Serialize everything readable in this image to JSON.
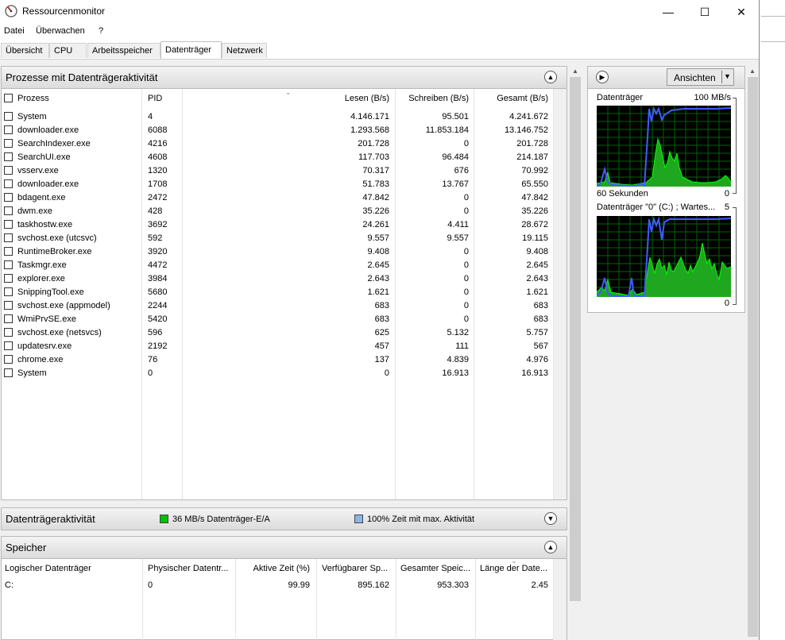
{
  "window": {
    "title": "Ressourcenmonitor",
    "minimize": "—",
    "maximize": "☐",
    "close": "✕"
  },
  "menu": [
    "Datei",
    "Überwachen",
    "?"
  ],
  "tabs": [
    "Übersicht",
    "CPU",
    "Arbeitsspeicher",
    "Datenträger",
    "Netzwerk"
  ],
  "active_tab": "Datenträger",
  "processes": {
    "title": "Prozesse mit Datenträgeraktivität",
    "columns": [
      "Prozess",
      "PID",
      "Lesen (B/s)",
      "Schreiben (B/s)",
      "Gesamt (B/s)"
    ],
    "rows": [
      [
        "System",
        "4",
        "4.146.171",
        "95.501",
        "4.241.672"
      ],
      [
        "downloader.exe",
        "6088",
        "1.293.568",
        "11.853.184",
        "13.146.752"
      ],
      [
        "SearchIndexer.exe",
        "4216",
        "201.728",
        "0",
        "201.728"
      ],
      [
        "SearchUI.exe",
        "4608",
        "117.703",
        "96.484",
        "214.187"
      ],
      [
        "vsserv.exe",
        "1320",
        "70.317",
        "676",
        "70.992"
      ],
      [
        "downloader.exe",
        "1708",
        "51.783",
        "13.767",
        "65.550"
      ],
      [
        "bdagent.exe",
        "2472",
        "47.842",
        "0",
        "47.842"
      ],
      [
        "dwm.exe",
        "428",
        "35.226",
        "0",
        "35.226"
      ],
      [
        "taskhostw.exe",
        "3692",
        "24.261",
        "4.411",
        "28.672"
      ],
      [
        "svchost.exe (utcsvc)",
        "592",
        "9.557",
        "9.557",
        "19.115"
      ],
      [
        "RuntimeBroker.exe",
        "3920",
        "9.408",
        "0",
        "9.408"
      ],
      [
        "Taskmgr.exe",
        "4472",
        "2.645",
        "0",
        "2.645"
      ],
      [
        "explorer.exe",
        "3984",
        "2.643",
        "0",
        "2.643"
      ],
      [
        "SnippingTool.exe",
        "5680",
        "1.621",
        "0",
        "1.621"
      ],
      [
        "svchost.exe (appmodel)",
        "2244",
        "683",
        "0",
        "683"
      ],
      [
        "WmiPrvSE.exe",
        "5420",
        "683",
        "0",
        "683"
      ],
      [
        "svchost.exe (netsvcs)",
        "596",
        "625",
        "5.132",
        "5.757"
      ],
      [
        "updatesrv.exe",
        "2192",
        "457",
        "111",
        "567"
      ],
      [
        "chrome.exe",
        "76",
        "137",
        "4.839",
        "4.976"
      ],
      [
        "System",
        "0",
        "0",
        "16.913",
        "16.913"
      ]
    ]
  },
  "disk_activity": {
    "title": "Datenträgeraktivität",
    "io_text": "36 MB/s Datenträger-E/A",
    "time_text": "100% Zeit mit max. Aktivität",
    "io_color": "#00c000",
    "time_color": "#8cb4e8"
  },
  "storage": {
    "title": "Speicher",
    "columns": [
      "Logischer Datenträger",
      "Physischer Datentr...",
      "Aktive Zeit (%)",
      "Verfügbarer Sp...",
      "Gesamter Speic...",
      "Länge der Date..."
    ],
    "rows": [
      [
        "C:",
        "0",
        "99.99",
        "895.162",
        "953.303",
        "2.45"
      ]
    ]
  },
  "side_panel": {
    "views_button": "Ansichten",
    "graph1": {
      "label": "Datenträger",
      "max": "100 MB/s",
      "footer_left": "60 Sekunden",
      "footer_right": "0"
    },
    "graph2": {
      "label": "Datenträger \"0\" (C:) ; Wartes...",
      "max": "5",
      "footer_right": "0"
    }
  }
}
